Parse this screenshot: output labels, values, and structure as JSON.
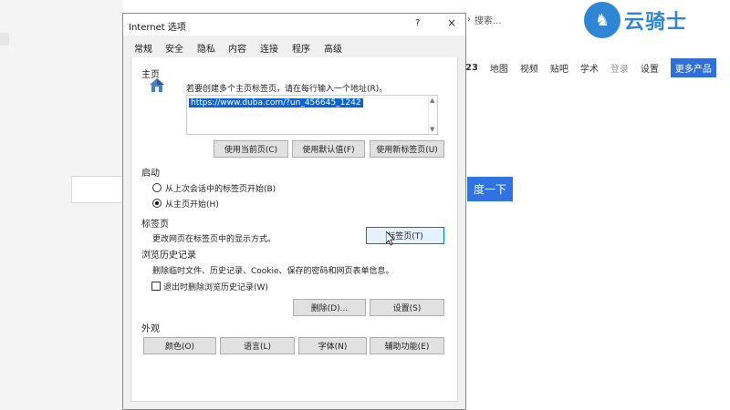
{
  "background": {
    "search_hint": "搜索...",
    "logo_text": "云骑士",
    "nav": {
      "partial_number": "23",
      "items": [
        "地图",
        "视频",
        "贴吧",
        "学术"
      ],
      "login": "登录",
      "settings": "设置",
      "more": "更多产品"
    },
    "search_button": "度一下"
  },
  "dialog": {
    "title": "Internet 选项",
    "help_button": "?",
    "close_button": "×",
    "tabs": [
      "常规",
      "安全",
      "隐私",
      "内容",
      "连接",
      "程序",
      "高级"
    ],
    "home": {
      "heading": "主页",
      "instruction": "若要创建多个主页标签页，请在每行输入一个地址(R)。",
      "url": "https://www.duba.com/?un_456645_1242",
      "btn_current": "使用当前页(C)",
      "btn_default": "使用默认值(F)",
      "btn_new_tab": "使用新标签页(U)"
    },
    "startup": {
      "heading": "启动",
      "option_last": "从上次会话中的标签页开始(B)",
      "option_home": "从主页开始(H)"
    },
    "tabs_section": {
      "heading": "标签页",
      "description": "更改网页在标签页中的显示方式。",
      "button": "标签页(T)"
    },
    "history": {
      "heading": "浏览历史记录",
      "description": "删除临时文件、历史记录、Cookie、保存的密码和网页表单信息。",
      "checkbox_label": "退出时删除浏览历史记录(W)",
      "btn_delete": "删除(D)...",
      "btn_settings": "设置(S)"
    },
    "appearance": {
      "heading": "外观",
      "btn_colors": "颜色(O)",
      "btn_languages": "语言(L)",
      "btn_fonts": "字体(N)",
      "btn_accessibility": "辅助功能(E)"
    }
  },
  "colors": {
    "accent": "#0078d7",
    "selection": "#0a64d6",
    "brand": "#2f86d4"
  }
}
